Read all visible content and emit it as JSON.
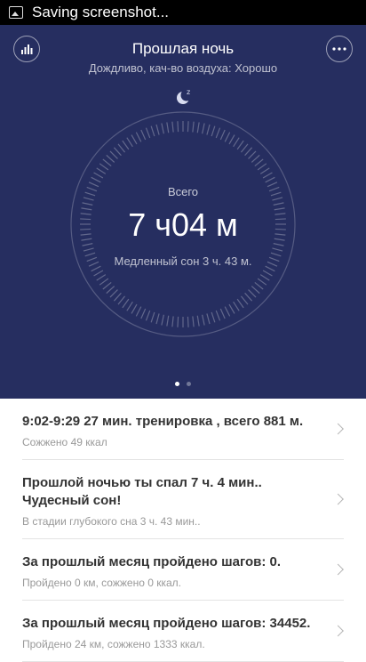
{
  "status_bar": {
    "text": "Saving screenshot..."
  },
  "header": {
    "title": "Прошлая ночь",
    "subtitle": "Дождливо, кач-во воздуха: Хорошо"
  },
  "sleep_summary": {
    "label": "Всего",
    "value": "7 ч04 м",
    "detail": "Медленный сон 3 ч. 43 м."
  },
  "pager": {
    "pages": 2,
    "active": 0
  },
  "cards": [
    {
      "title": "9:02-9:29  27 мин. тренировка , всего 881 м.",
      "subtitle": "Сожжено 49 ккал"
    },
    {
      "title": "Прошлой ночью ты спал 7 ч. 4 мин.. Чудесный сон!",
      "subtitle": "В стадии глубокого сна 3 ч. 43 мин.."
    },
    {
      "title": "За прошлый месяц пройдено шагов: 0.",
      "subtitle": "Пройдено 0 км, сожжено 0 ккал."
    },
    {
      "title": "За прошлый месяц пройдено шагов: 34452.",
      "subtitle": "Пройдено 24 км, сожжено 1333 ккал."
    }
  ],
  "colors": {
    "hero_bg": "#262e60",
    "list_bg": "#ffffff"
  },
  "icons": {
    "left": "bar-chart-icon",
    "right": "more-icon",
    "moon": "moon-icon",
    "status": "image-icon"
  }
}
